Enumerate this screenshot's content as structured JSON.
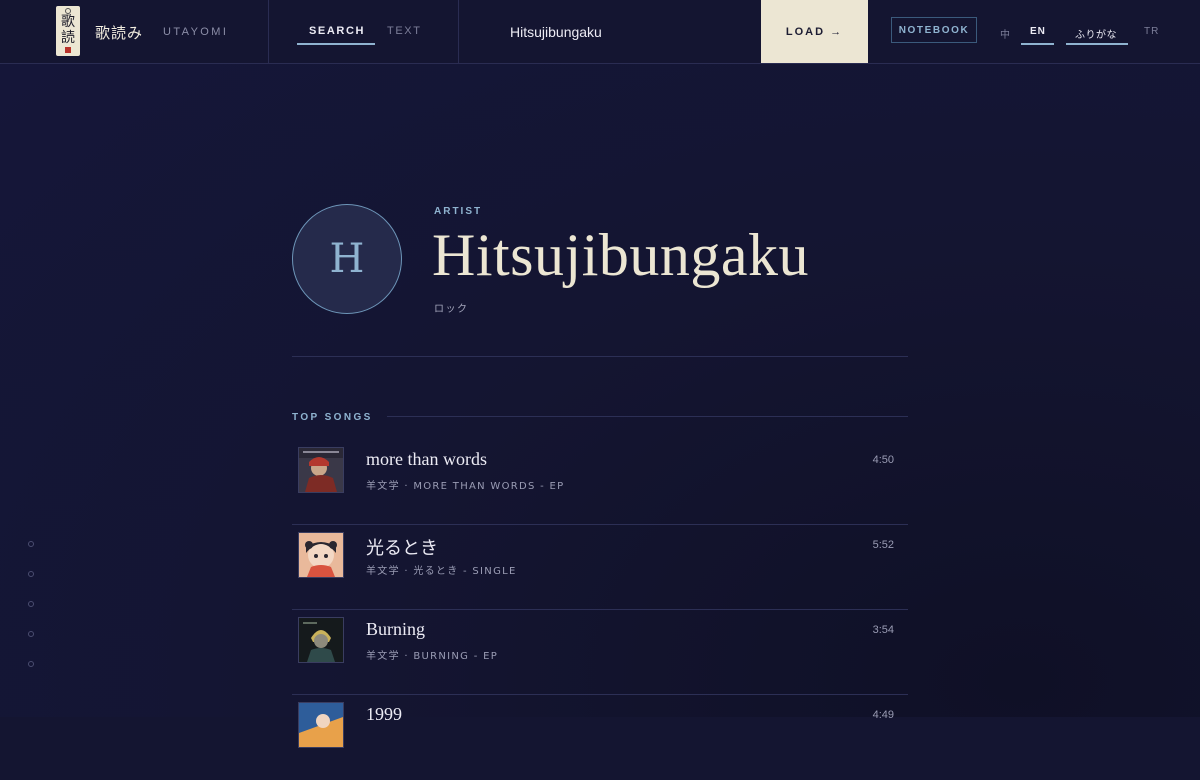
{
  "brand": {
    "logo_glyphs": [
      "歌",
      "読"
    ],
    "name_jp": "歌読み",
    "name_en": "UTAYOMI"
  },
  "modes": {
    "search_label": "SEARCH",
    "text_label": "TEXT"
  },
  "search": {
    "value": "Hitsujibungaku"
  },
  "actions": {
    "load_label": "LOAD →",
    "notebook_label": "NOTEBOOK"
  },
  "languages": {
    "zh": "中",
    "en": "EN",
    "furigana": "ふりがな",
    "tr": "TR"
  },
  "artist": {
    "kicker": "ARTIST",
    "initial": "H",
    "name": "Hitsujibungaku",
    "genre": "ロック"
  },
  "top_songs": {
    "title": "TOP SONGS",
    "items": [
      {
        "title": "more than words",
        "meta": "羊文学 · MORE THAN WORDS - EP",
        "duration": "4:50",
        "art_icon": "album-art-more-than-words"
      },
      {
        "title": "光るとき",
        "meta": "羊文学 · 光るとき - SINGLE",
        "duration": "5:52",
        "art_icon": "album-art-hikaru-toki"
      },
      {
        "title": "Burning",
        "meta": "羊文学 · BURNING - EP",
        "duration": "3:54",
        "art_icon": "album-art-burning"
      },
      {
        "title": "1999",
        "meta": "",
        "duration": "4:49",
        "art_icon": "album-art-1999"
      }
    ]
  },
  "colors": {
    "background": "#141531",
    "accent": "#8fb3d0",
    "cream": "#ece6d3",
    "divider": "#2c2f55"
  }
}
